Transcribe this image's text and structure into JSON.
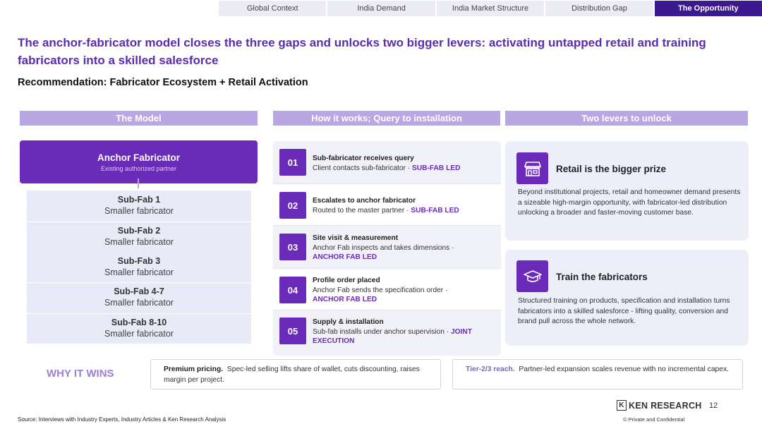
{
  "nav": {
    "tabs": [
      "Global Context",
      "India Demand",
      "India Market Structure",
      "Distribution Gap",
      "The Opportunity"
    ],
    "active_tab": "The Opportunity"
  },
  "header": {
    "title": "The anchor-fabricator model closes the three gaps and unlocks two bigger levers: activating untapped retail and training fabricators into a skilled salesforce",
    "subtitle": "Recommendation: Fabricator Ecosystem + Retail Activation"
  },
  "columns": {
    "model": "The Model",
    "how": "How it works; Query to installation",
    "levers": "Two levers to unlock"
  },
  "model": {
    "anchor_title": "Anchor Fabricator",
    "anchor_sub": "Existing authorized partner",
    "subfabs": [
      {
        "name": "Sub-Fab 1",
        "desc": "Smaller fabricator"
      },
      {
        "name": "Sub-Fab 2",
        "desc": "Smaller fabricator"
      },
      {
        "name": "Sub-Fab 3",
        "desc": "Smaller fabricator"
      },
      {
        "name": "Sub-Fab 4-7",
        "desc": "Smaller fabricator"
      },
      {
        "name": "Sub-Fab 8-10",
        "desc": "Smaller fabricator"
      }
    ]
  },
  "steps": [
    {
      "num": "01",
      "title": "Sub-fabricator receives query",
      "body": "Client contacts sub-fabricator",
      "tag": "SUB-FAB LED"
    },
    {
      "num": "02",
      "title": "Escalates to anchor fabricator",
      "body": "Routed to the master partner",
      "tag": "SUB-FAB LED"
    },
    {
      "num": "03",
      "title": "Site visit & measurement",
      "body": "Anchor Fab inspects and takes dimensions",
      "tag": "ANCHOR FAB LED"
    },
    {
      "num": "04",
      "title": "Profile order placed",
      "body": "Anchor Fab sends the specification order",
      "tag": "ANCHOR FAB LED"
    },
    {
      "num": "05",
      "title": "Supply & installation",
      "body": "Sub-fab installs under anchor supervision",
      "tag": "JOINT EXECUTION"
    }
  ],
  "levers": [
    {
      "icon": "storefront-icon",
      "title": "Retail is the bigger prize",
      "body": "Beyond institutional projects, retail and homeowner demand presents a sizeable high-margin opportunity, with fabricator-led distribution unlocking a broader and faster-moving customer base."
    },
    {
      "icon": "graduation-cap-icon",
      "title": "Train the fabricators",
      "body": "Structured training on products, specification and installation turns fabricators into a skilled salesforce - lifting quality, conversion and brand pull across the whole network."
    }
  ],
  "why": {
    "label": "WHY IT WINS",
    "points": [
      {
        "bold": "Premium pricing.",
        "text": "Spec-led selling lifts share of wallet, cuts discounting, raises margin per project."
      },
      {
        "bold": "Tier-2/3 reach.",
        "text": "Partner-led expansion scales revenue with no incremental capex."
      }
    ]
  },
  "footer": {
    "source": "Source: Interviews with Industry Experts, Industry Articles & Ken Research Analysis",
    "brand": "KEN RESEARCH",
    "page": "12",
    "confidential": "© Private and Confidential"
  },
  "colors": {
    "accent": "#6a2bb8",
    "header_band": "#b8a7e3",
    "title": "#5b2bb0",
    "panel": "#eceff9"
  }
}
